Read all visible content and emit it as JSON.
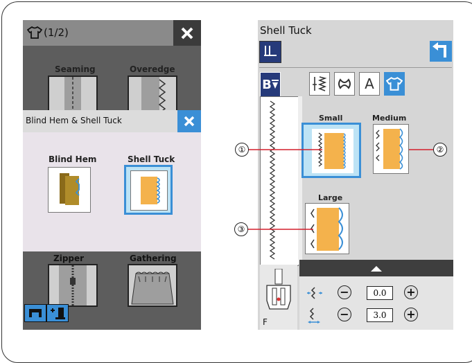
{
  "left_screen": {
    "header_title": "(1/2)",
    "tiles": {
      "seaming": "Seaming",
      "overedge": "Overedge",
      "zipper": "Zipper",
      "gathering": "Gathering"
    },
    "dialog": {
      "title": "Blind Hem & Shell Tuck",
      "blind_hem_label": "Blind Hem",
      "shell_tuck_label": "Shell Tuck"
    }
  },
  "right_screen": {
    "title": "Shell Tuck",
    "category_tab_letter": "A",
    "side_tab_label": "B",
    "options": {
      "small": "Small",
      "medium": "Medium",
      "large": "Large"
    },
    "foot_letter": "F",
    "width_value": "0.0",
    "length_value": "3.0",
    "minus_symbol": "−",
    "plus_symbol": "+"
  },
  "callouts": [
    "①",
    "②",
    "③"
  ],
  "colors": {
    "accent_blue": "#3a8fd6",
    "selected_bg": "#bde3f5",
    "fabric_orange": "#f4b24c"
  }
}
